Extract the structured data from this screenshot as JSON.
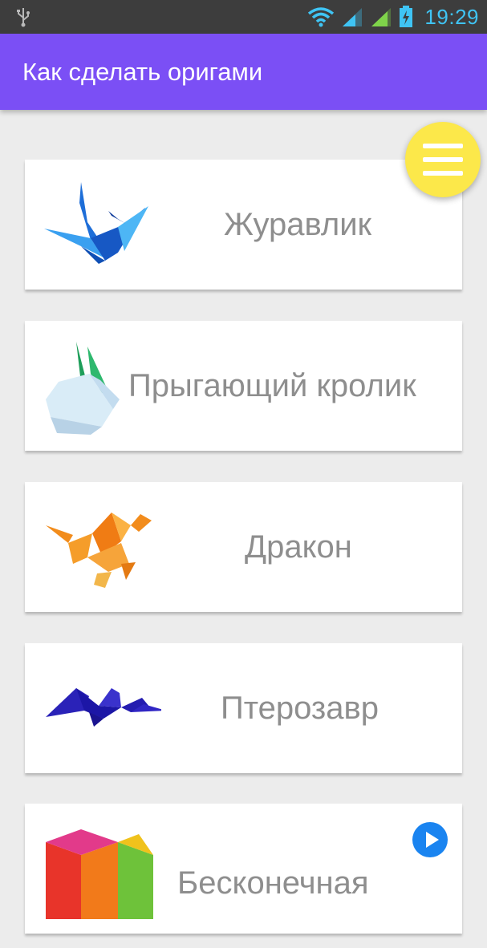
{
  "status_bar": {
    "time": "19:29"
  },
  "app_bar": {
    "title": "Как сделать оригами"
  },
  "menu_button": {
    "icon": "hamburger-menu-icon",
    "color": "#fce84a"
  },
  "items": [
    {
      "label": "Журавлик",
      "icon": "origami-crane-icon"
    },
    {
      "label": "Прыгающий кролик",
      "icon": "origami-rabbit-icon"
    },
    {
      "label": "Дракон",
      "icon": "origami-dragon-icon"
    },
    {
      "label": "Птерозавр",
      "icon": "origami-pterosaur-icon"
    },
    {
      "label": "Бесконечная",
      "icon": "origami-infinity-cube-icon"
    }
  ],
  "colors": {
    "app_bar": "#7b4ff5",
    "accent": "#fce84a",
    "status_bar": "#3d3d3d"
  }
}
